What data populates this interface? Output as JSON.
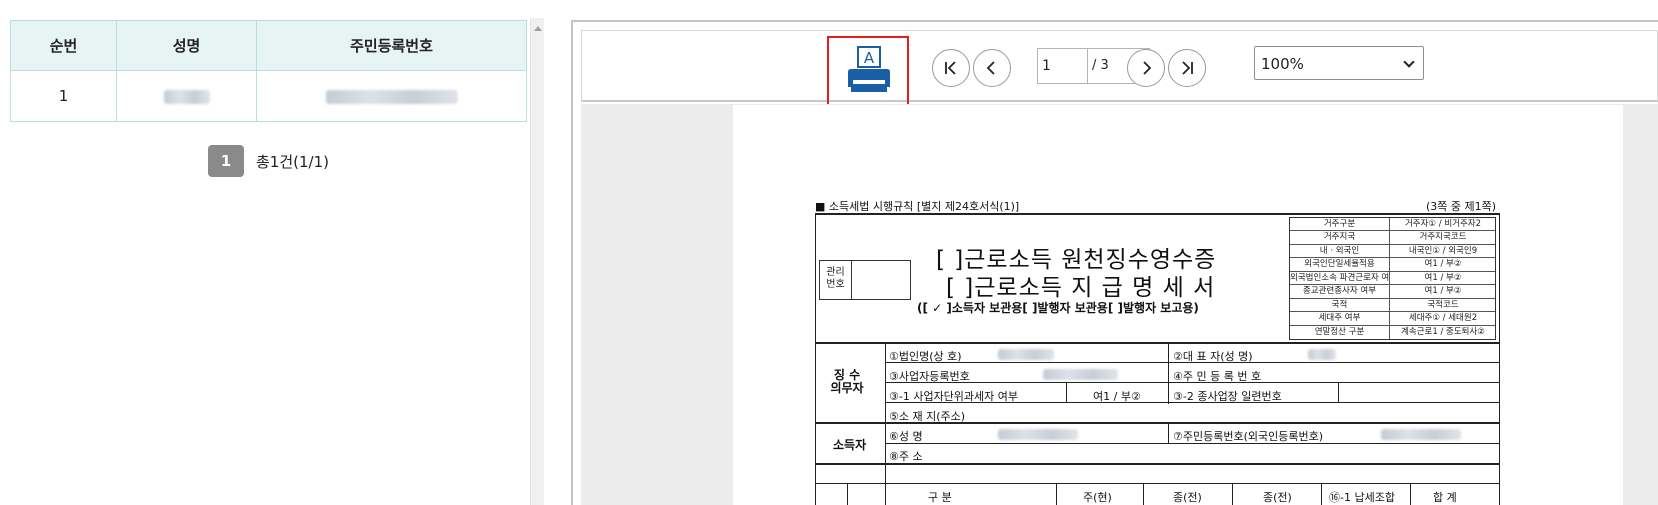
{
  "list": {
    "columns": [
      "순번",
      "성명",
      "주민등록번호"
    ],
    "rows": [
      {
        "no": "1"
      }
    ],
    "pager": {
      "current": "1",
      "total_text": "총1건(1/1)"
    }
  },
  "viewer": {
    "page_input": "1",
    "page_total": "/ 3",
    "zoom": "100%",
    "print_icon_letter": "A"
  },
  "form": {
    "header_left": "■ 소득세법 시행규칙 [별지 제24호서식(1)]",
    "header_right": "(3쪽 중 제1쪽)",
    "title1": "[  ]근로소득 원천징수영수증",
    "title2": "[  ]근로소득 지 급 명 세 서",
    "subtitle": "([ ✓ ]소득자 보관용[      ]발행자 보관용[      ]발행자 보고용)",
    "mgmt_label": "관리 번호",
    "side_table": [
      [
        "거주구분",
        "거주자① / 비거주자2"
      ],
      [
        "거주지국",
        "거주지국코드"
      ],
      [
        "내 · 외국인",
        "내국인① / 외국인9"
      ],
      [
        "외국인단일세율적용",
        "여1 / 부②"
      ],
      [
        "외국법인소속 파견근로자 여부",
        "여1 / 부②"
      ],
      [
        "종교관련종사자 여부",
        "여1 / 부②"
      ],
      [
        "국적",
        "국적코드"
      ],
      [
        "세대주 여부",
        "세대주① / 세대원2"
      ],
      [
        "연말정산 구분",
        "계속근로1 / 중도퇴사②"
      ]
    ],
    "payer_label": "징 수 의무자",
    "earner_label": "소득자",
    "f1": "①법인명(상  호)",
    "f2": "②대 표 자(성   명)",
    "f3": "③사업자등록번호",
    "f4": "④주 민 등 록 번 호",
    "f3_1": "③-1 사업자단위과세자 여부",
    "f3_1_val": "여1 / 부②",
    "f3_2": "③-2 종사업장 일련번호",
    "f5": "⑤소 재 지(주소)",
    "f6": "⑥성         명",
    "f7": "⑦주민등록번호(외국인등록번호)",
    "f8": "⑧주         소",
    "bottom_headers": [
      "구        분",
      "주(현)",
      "종(전)",
      "종(전)",
      "⑯-1 납세조합",
      "합    계"
    ]
  }
}
